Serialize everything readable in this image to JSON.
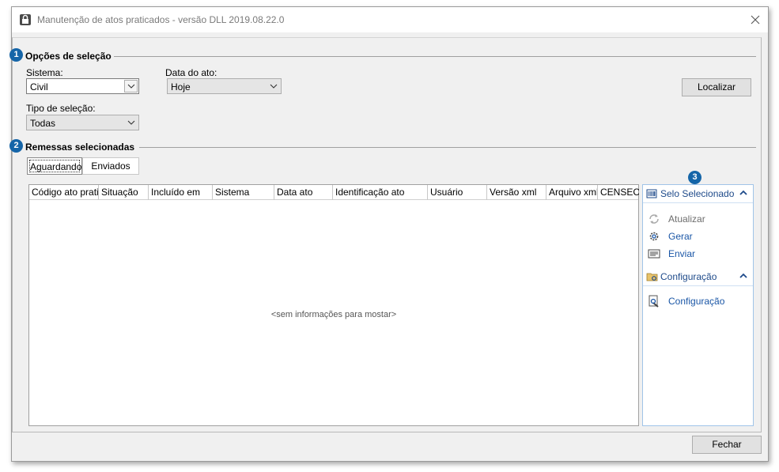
{
  "window": {
    "title": "Manutenção de atos praticados  - versão DLL 2019.08.22.0"
  },
  "icons": {
    "app": "lock-app-icon",
    "close": "close-icon",
    "dropdown": "chevron-down-icon",
    "selo_header": "barcode-icon",
    "atualizar": "refresh-icon",
    "gerar": "gear-icon",
    "enviar": "send-xml-icon",
    "configuracao_header": "folder-config-icon",
    "configuracao_item": "wrench-doc-icon",
    "collapse": "chevron-up-icon"
  },
  "colors": {
    "badge": "#1565a8",
    "link": "#1a56a6",
    "panel_header": "#1e4a8a"
  },
  "badges": [
    "1",
    "2",
    "3"
  ],
  "opcoes": {
    "title": "Opções de seleção",
    "sistema_label": "Sistema:",
    "sistema_value": "Civil",
    "data_label": "Data do ato:",
    "data_value": "Hoje",
    "tipo_label": "Tipo de seleção:",
    "tipo_value": "Todas",
    "localizar_label": "Localizar"
  },
  "remessas": {
    "title": "Remessas selecionadas",
    "tabs": [
      {
        "label": "Aguardando"
      },
      {
        "label": "Enviados"
      }
    ],
    "columns": [
      "Código ato praticado",
      "Situação",
      "Incluído em",
      "Sistema",
      "Data ato",
      "Identificação ato",
      "Usuário",
      "Versão xml",
      "Arquivo xml",
      "CENSEC"
    ],
    "empty_message": "<sem informações para mostar>"
  },
  "side_panel": {
    "selo_title": "Selo Selecionado",
    "items": [
      {
        "label": "Atualizar"
      },
      {
        "label": "Gerar"
      },
      {
        "label": "Enviar"
      }
    ],
    "config_title": "Configuração",
    "config_item": "Configuração"
  },
  "footer": {
    "fechar_label": "Fechar"
  }
}
